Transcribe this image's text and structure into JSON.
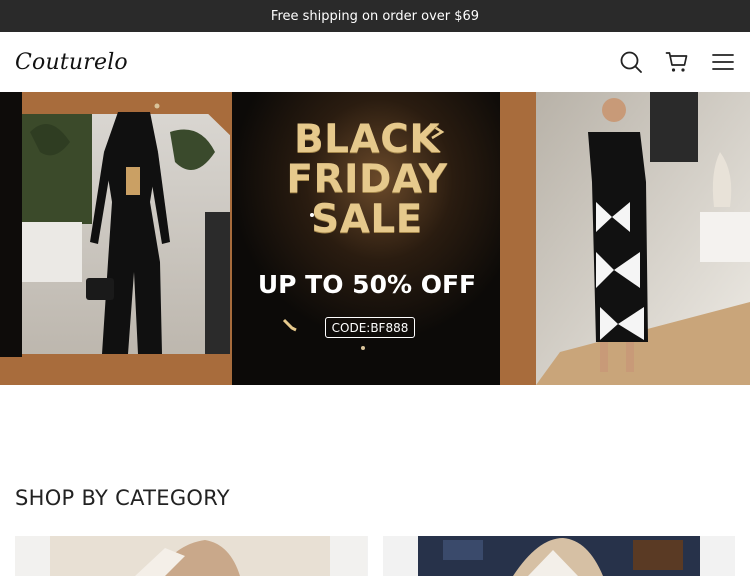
{
  "announcement": {
    "text": "Free shipping on order over $69"
  },
  "header": {
    "logo": "Couturelo",
    "icons": [
      "search-icon",
      "cart-icon",
      "menu-icon"
    ]
  },
  "banner": {
    "title_line1": "BLACK",
    "title_line2": "FRIDAY",
    "title_line3": "SALE",
    "subtitle": "UP TO 50% OFF",
    "code": "CODE:BF888",
    "colors": {
      "gold": "#e6c98c",
      "bronze": "#a86c3c",
      "dark": "#111111"
    }
  },
  "section": {
    "title": "SHOP BY CATEGORY"
  },
  "categories": [
    {
      "image": "category-image-1"
    },
    {
      "image": "category-image-2"
    }
  ]
}
